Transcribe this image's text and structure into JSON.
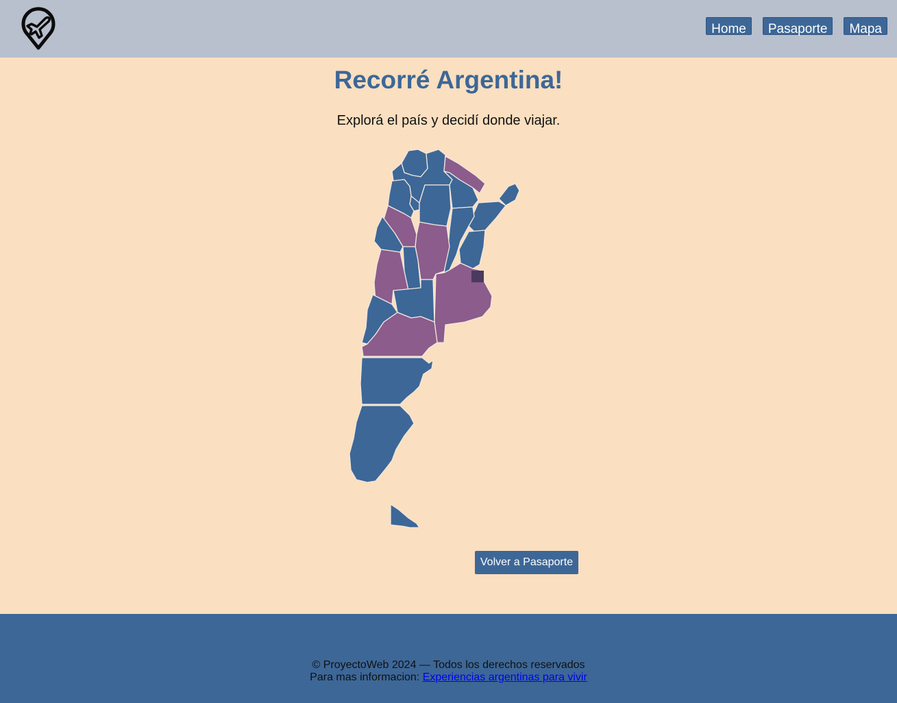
{
  "header": {
    "logo_icon": "plane-location-pin-icon",
    "nav": {
      "home_label": "Home",
      "passport_label": "Pasaporte",
      "map_label": "Mapa"
    }
  },
  "main": {
    "title": "Recorré Argentina!",
    "subtitle": "Explorá el país y decidí donde viajar.",
    "back_button_label": "Volver a Pasaporte"
  },
  "map": {
    "default_color": "#3d6797",
    "visited_color": "#8b5c8c",
    "cursor_marker_color": "#4a3a5e"
  },
  "footer": {
    "copyright": "© ProyectoWeb 2024 — Todos los derechos reservados",
    "info_prefix": "Para mas informacion: ",
    "link_text": "Experiencias argentinas para vivir"
  },
  "colors": {
    "background": "#fadfc0",
    "header_bg": "#b8bfcd",
    "accent": "#3d6797"
  }
}
